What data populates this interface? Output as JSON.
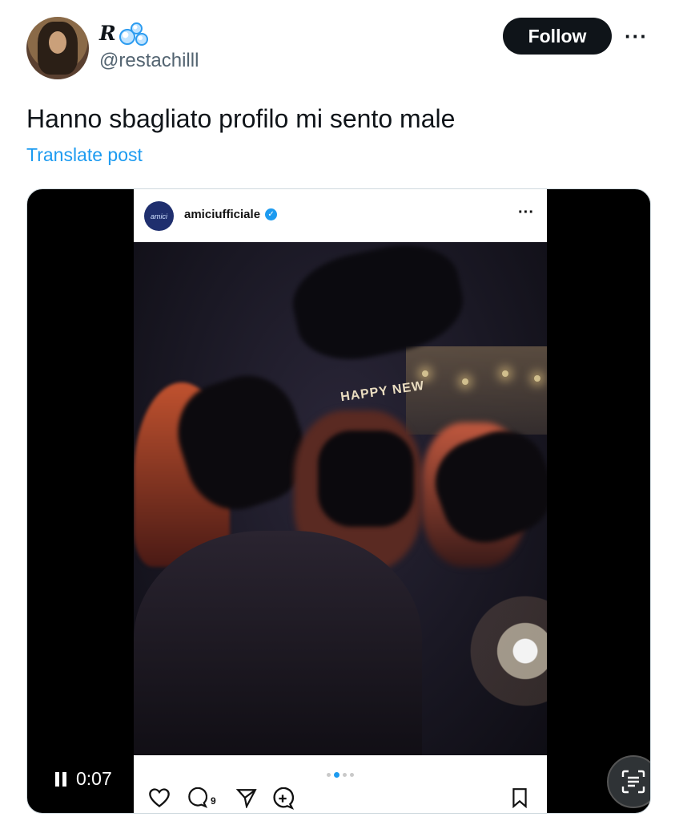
{
  "author": {
    "display_name": "R",
    "handle": "@restachilll",
    "avatar_icon": "profile-photo"
  },
  "header": {
    "follow_label": "Follow",
    "more_label": "···"
  },
  "tweet": {
    "text": "Hanno sbagliato profilo mi sento male",
    "translate_label": "Translate post"
  },
  "video": {
    "time": "0:07",
    "state_icon": "pause-icon",
    "embedded_post": {
      "account": "amiciufficiale",
      "avatar_text": "amici",
      "more_label": "···",
      "comment_count": "9",
      "carousel_dots": 4,
      "active_dot": 1
    }
  },
  "colors": {
    "accent": "#1d9bf0",
    "follow_bg": "#0f1419",
    "handle": "#536471"
  }
}
